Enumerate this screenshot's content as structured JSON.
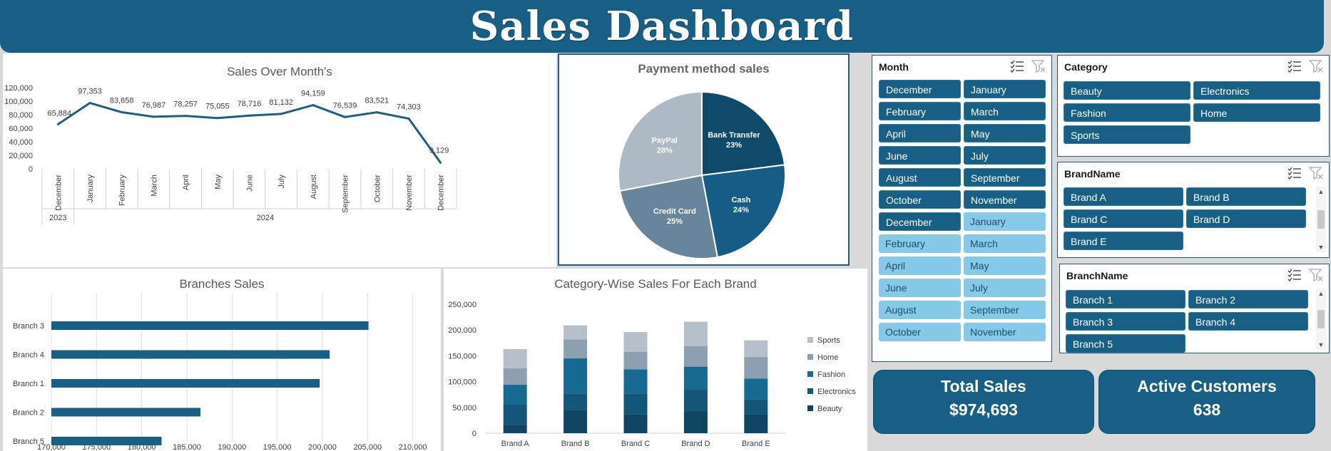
{
  "dashboard": {
    "title": "Sales Dashboard"
  },
  "colors": {
    "primary": "#175f85",
    "line": "#1f5f82",
    "slicer_selected": "#175f85",
    "slicer_unselected": "#86c9e8",
    "pie": [
      "#0f4a6b",
      "#155d86",
      "#67859b",
      "#adb9c4"
    ],
    "stack": [
      "#0f4463",
      "#135677",
      "#176a92",
      "#8da0b2",
      "#b5c0ca"
    ]
  },
  "chart_data": [
    {
      "type": "line",
      "title": "Sales Over Month's",
      "x": [
        "December",
        "January",
        "February",
        "March",
        "April",
        "May",
        "June",
        "July",
        "August",
        "September",
        "October",
        "November",
        "December"
      ],
      "x_groups": [
        {
          "label": "2023",
          "span": 1
        },
        {
          "label": "2024",
          "span": 12
        }
      ],
      "values": [
        65884,
        97353,
        83658,
        76987,
        78257,
        75055,
        78716,
        81132,
        94159,
        76539,
        83521,
        74303,
        9129
      ],
      "data_labels": [
        "65,884",
        "97,353",
        "83,658",
        "76,987",
        "78,257",
        "75,055",
        "78,716",
        "81,132",
        "94,159",
        "76,539",
        "83,521",
        "74,303",
        "9,129"
      ],
      "y_ticks": [
        "0",
        "20,000",
        "40,000",
        "60,000",
        "80,000",
        "100,000",
        "120,000"
      ],
      "ylim": [
        0,
        120000
      ]
    },
    {
      "type": "pie",
      "title": "Payment method sales",
      "slices": [
        {
          "label": "Bank Transfer",
          "pct_label": "23%",
          "value": 23
        },
        {
          "label": "Cash",
          "pct_label": "24%",
          "value": 24
        },
        {
          "label": "Credit Card",
          "pct_label": "25%",
          "value": 25
        },
        {
          "label": "PayPal",
          "pct_label": "28%",
          "value": 28
        }
      ]
    },
    {
      "type": "bar",
      "orientation": "horizontal",
      "title": "Branches Sales",
      "categories": [
        "Branch 3",
        "Branch 4",
        "Branch 1",
        "Branch 2",
        "Branch 5"
      ],
      "values": [
        205100,
        200800,
        199700,
        186500,
        182200
      ],
      "x_ticks": [
        "170,000",
        "175,000",
        "180,000",
        "185,000",
        "190,000",
        "195,000",
        "200,000",
        "205,000",
        "210,000"
      ],
      "xlim": [
        170000,
        212000
      ]
    },
    {
      "type": "bar",
      "stacked": true,
      "title": "Category-Wise Sales For Each Brand",
      "categories": [
        "Brand A",
        "Brand B",
        "Brand C",
        "Brand D",
        "Brand E"
      ],
      "series": [
        {
          "name": "Beauty",
          "values": [
            16000,
            45000,
            37000,
            44000,
            36000
          ]
        },
        {
          "name": "Electronics",
          "values": [
            40000,
            32000,
            40000,
            41000,
            29000
          ]
        },
        {
          "name": "Fashion",
          "values": [
            38000,
            68000,
            47000,
            44000,
            41000
          ]
        },
        {
          "name": "Home",
          "values": [
            32000,
            37000,
            34000,
            40000,
            42000
          ]
        },
        {
          "name": "Sports",
          "values": [
            37000,
            27000,
            38000,
            47000,
            32000
          ]
        }
      ],
      "legend_order": [
        "Sports",
        "Home",
        "Fashion",
        "Electronics",
        "Beauty"
      ],
      "y_ticks": [
        "0",
        "50,000",
        "100,000",
        "150,000",
        "200,000",
        "250,000"
      ],
      "ylim": [
        0,
        250000
      ],
      "legend_position": "right"
    }
  ],
  "slicers": {
    "month": {
      "title": "Month",
      "items": [
        {
          "label": "December",
          "selected": true
        },
        {
          "label": "January",
          "selected": true
        },
        {
          "label": "February",
          "selected": true
        },
        {
          "label": "March",
          "selected": true
        },
        {
          "label": "April",
          "selected": true
        },
        {
          "label": "May",
          "selected": true
        },
        {
          "label": "June",
          "selected": true
        },
        {
          "label": "July",
          "selected": true
        },
        {
          "label": "August",
          "selected": true
        },
        {
          "label": "September",
          "selected": true
        },
        {
          "label": "October",
          "selected": true
        },
        {
          "label": "November",
          "selected": true
        },
        {
          "label": "December",
          "selected": true
        },
        {
          "label": "January",
          "selected": false
        },
        {
          "label": "February",
          "selected": false
        },
        {
          "label": "March",
          "selected": false
        },
        {
          "label": "April",
          "selected": false
        },
        {
          "label": "May",
          "selected": false
        },
        {
          "label": "June",
          "selected": false
        },
        {
          "label": "July",
          "selected": false
        },
        {
          "label": "August",
          "selected": false
        },
        {
          "label": "September",
          "selected": false
        },
        {
          "label": "October",
          "selected": false
        },
        {
          "label": "November",
          "selected": false
        }
      ]
    },
    "category": {
      "title": "Category",
      "items": [
        {
          "label": "Beauty",
          "selected": true
        },
        {
          "label": "Electronics",
          "selected": true
        },
        {
          "label": "Fashion",
          "selected": true
        },
        {
          "label": "Home",
          "selected": true
        },
        {
          "label": "Sports",
          "selected": true
        }
      ]
    },
    "brand": {
      "title": "BrandName",
      "items": [
        {
          "label": "Brand A",
          "selected": true
        },
        {
          "label": "Brand B",
          "selected": true
        },
        {
          "label": "Brand C",
          "selected": true
        },
        {
          "label": "Brand D",
          "selected": true
        },
        {
          "label": "Brand E",
          "selected": true
        }
      ]
    },
    "branch": {
      "title": "BranchName",
      "items": [
        {
          "label": "Branch 1",
          "selected": true
        },
        {
          "label": "Branch 2",
          "selected": true
        },
        {
          "label": "Branch 3",
          "selected": true
        },
        {
          "label": "Branch 4",
          "selected": true
        },
        {
          "label": "Branch 5",
          "selected": true
        }
      ]
    }
  },
  "kpis": {
    "total_sales": {
      "label": "Total Sales",
      "value": "$974,693"
    },
    "active_customers": {
      "label": "Active Customers",
      "value": "638"
    }
  },
  "icons": {
    "multi_select": "multi-select-icon",
    "clear_filter": "clear-filter-icon"
  }
}
